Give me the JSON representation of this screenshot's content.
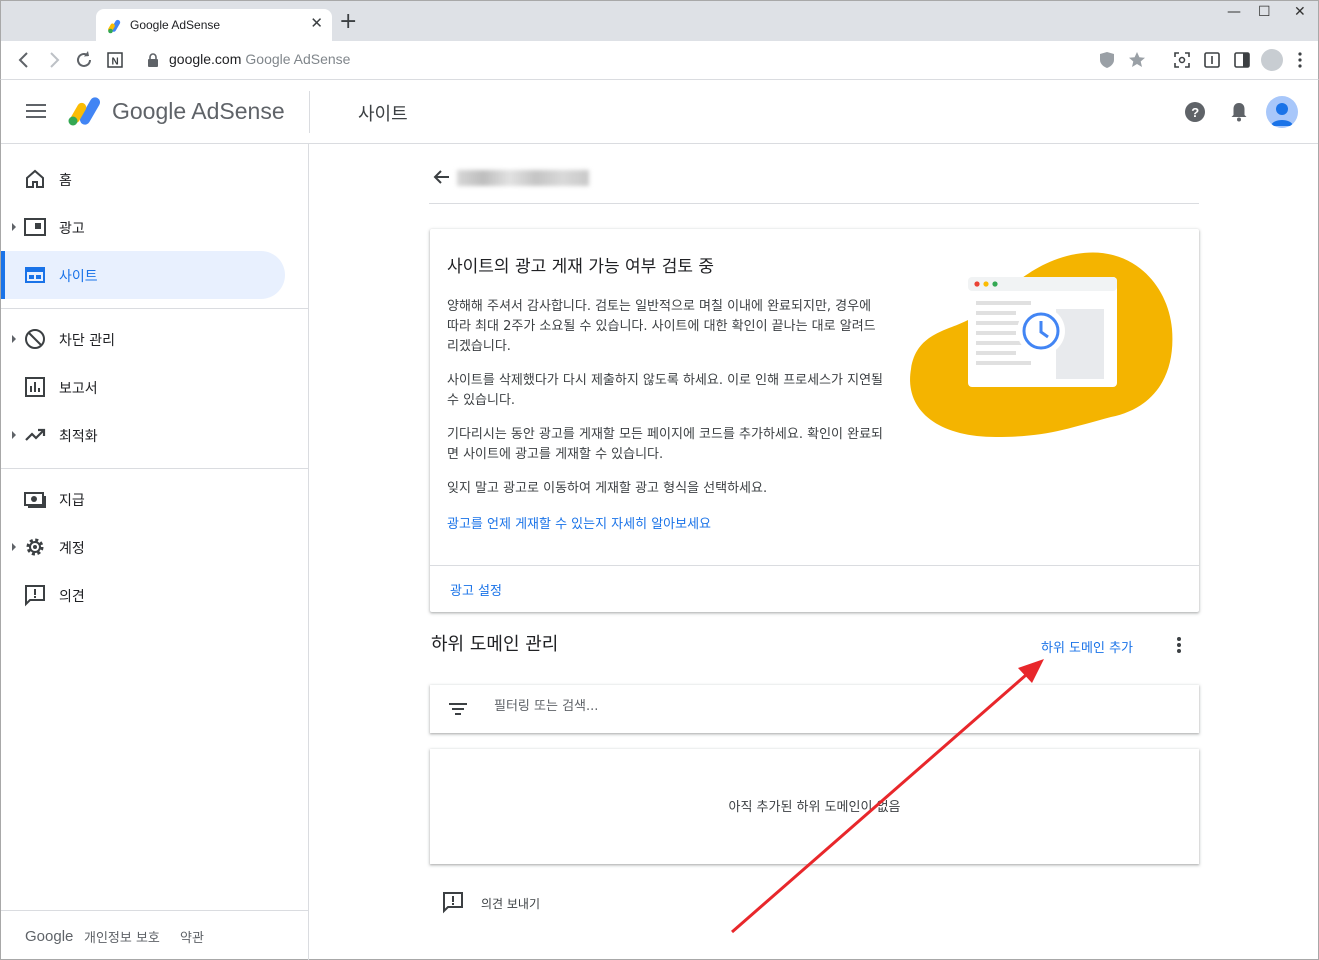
{
  "browser": {
    "tab_title": "Google AdSense",
    "url_host": "google.com",
    "url_rest": "Google AdSense"
  },
  "header": {
    "brand": "Google AdSense",
    "page_title": "사이트"
  },
  "sidebar": {
    "items": [
      {
        "label": "홈",
        "icon": "home-icon"
      },
      {
        "label": "광고",
        "icon": "ads-icon"
      },
      {
        "label": "사이트",
        "icon": "sites-icon"
      },
      {
        "label": "차단 관리",
        "icon": "block-icon"
      },
      {
        "label": "보고서",
        "icon": "reports-icon"
      },
      {
        "label": "최적화",
        "icon": "optimize-icon"
      },
      {
        "label": "지급",
        "icon": "payments-icon"
      },
      {
        "label": "계정",
        "icon": "gear-icon"
      },
      {
        "label": "의견",
        "icon": "feedback-icon"
      }
    ],
    "active_index": 2,
    "footer": {
      "brand": "Google",
      "privacy": "개인정보 보호",
      "terms": "약관"
    }
  },
  "review_card": {
    "title": "사이트의 광고 게재 가능 여부 검토 중",
    "p1": "양해해 주셔서 감사합니다. 검토는 일반적으로 며칠 이내에 완료되지만, 경우에 따라 최대 2주가 소요될 수 있습니다. 사이트에 대한 확인이 끝나는 대로 알려드리겠습니다.",
    "p2": "사이트를 삭제했다가 다시 제출하지 않도록 하세요. 이로 인해 프로세스가 지연될 수 있습니다.",
    "p3": "기다리시는 동안 광고를 게재할 모든 페이지에 코드를 추가하세요. 확인이 완료되면 사이트에 광고를 게재할 수 있습니다.",
    "p4": "잊지 말고 광고로 이동하여 게재할 광고 형식을 선택하세요.",
    "learn_link": "광고를 언제 게재할 수 있는지 자세히 알아보세요",
    "settings_link": "광고 설정"
  },
  "subdomains": {
    "title": "하위 도메인 관리",
    "add_button": "하위 도메인 추가",
    "filter_placeholder": "필터링 또는 검색...",
    "empty_text": "아직 추가된 하위 도메인이 없음"
  },
  "feedback_label": "의견 보내기",
  "colors": {
    "accent": "#1a73e8",
    "illustration_blob": "#f4b400",
    "annotation_arrow": "#e8272b"
  }
}
